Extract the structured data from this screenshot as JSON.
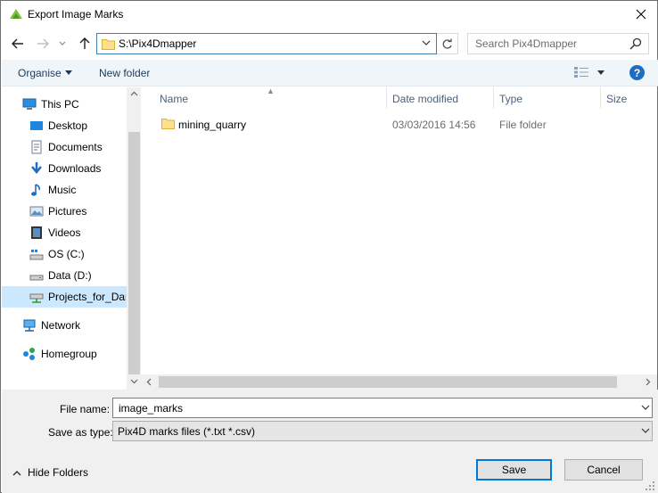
{
  "window": {
    "title": "Export Image Marks"
  },
  "address": {
    "path": "S:\\Pix4Dmapper",
    "search_placeholder": "Search Pix4Dmapper"
  },
  "toolbar": {
    "organise_label": "Organise",
    "new_folder_label": "New folder"
  },
  "nav": {
    "items": [
      {
        "label": "This PC",
        "icon": "computer-icon"
      },
      {
        "label": "Desktop",
        "icon": "desktop-icon"
      },
      {
        "label": "Documents",
        "icon": "documents-icon"
      },
      {
        "label": "Downloads",
        "icon": "downloads-icon"
      },
      {
        "label": "Music",
        "icon": "music-icon"
      },
      {
        "label": "Pictures",
        "icon": "pictures-icon"
      },
      {
        "label": "Videos",
        "icon": "videos-icon"
      },
      {
        "label": "OS (C:)",
        "icon": "os-drive-icon"
      },
      {
        "label": "Data (D:)",
        "icon": "drive-icon"
      },
      {
        "label": "Projects_for_Dar",
        "icon": "network-drive-icon"
      },
      {
        "label": "Network",
        "icon": "network-icon"
      },
      {
        "label": "Homegroup",
        "icon": "homegroup-icon"
      }
    ]
  },
  "list": {
    "columns": [
      "Name",
      "Date modified",
      "Type",
      "Size"
    ],
    "rows": [
      {
        "name": "mining_quarry",
        "date": "03/03/2016 14:56",
        "type": "File folder",
        "size": ""
      }
    ]
  },
  "footer": {
    "file_name_label": "File name:",
    "file_name_value": "image_marks",
    "save_type_label": "Save as type:",
    "save_type_value": "Pix4D marks files (*.txt *.csv)",
    "hide_folders_label": "Hide Folders",
    "save_label": "Save",
    "cancel_label": "Cancel"
  },
  "colors": {
    "accent": "#0078d7",
    "selection": "#cce8ff",
    "link": "#1e395b"
  }
}
